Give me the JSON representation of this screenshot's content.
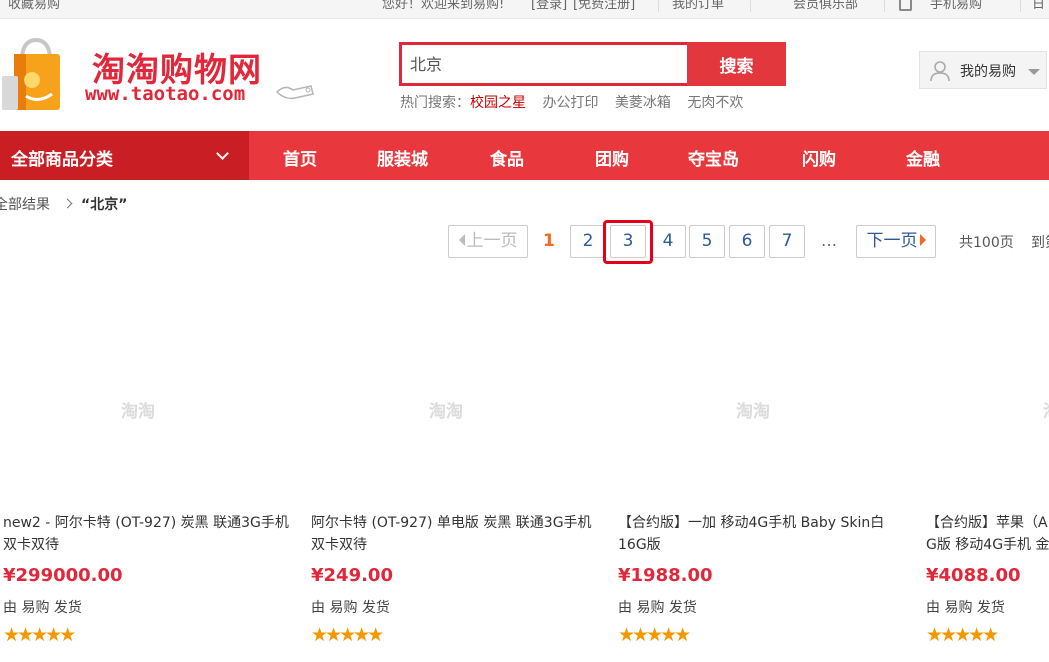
{
  "topbar": {
    "favorite": "收藏易购",
    "welcome": "您好！欢迎来到易购!",
    "login": "[登录]",
    "register": "[免费注册]",
    "my_orders": "我的订单",
    "member_club": "会员俱乐部",
    "mobile": "手机易购",
    "edge": "日"
  },
  "logo": {
    "title": "淘淘购物网",
    "url": "www.taotao.com"
  },
  "search": {
    "value": "北京",
    "button": "搜索",
    "hot_label": "热门搜索：",
    "hot_terms": [
      "校园之星",
      "办公打印",
      "美菱冰箱",
      "无肉不欢"
    ]
  },
  "mybuy": {
    "label": "我的易购"
  },
  "nav": {
    "all_categories": "全部商品分类",
    "items": [
      "首页",
      "服装城",
      "食品",
      "团购",
      "夺宝岛",
      "闪购",
      "金融"
    ]
  },
  "breadcrumb": {
    "root": "全部结果",
    "keyword": "“北京”"
  },
  "pager": {
    "prev": "上一页",
    "current": "1",
    "pages": [
      "2",
      "3",
      "4",
      "5",
      "6",
      "7"
    ],
    "ellipsis": "…",
    "next": "下一页",
    "total": "共100页",
    "goto": "到第"
  },
  "products": [
    {
      "watermark": "淘淘",
      "title": "new2 - 阿尔卡特 (OT-927) 炭黑 联通3G手机 双卡双待",
      "price": "¥299000.00",
      "shipping": "由 易购 发货",
      "rating_stars": 5
    },
    {
      "watermark": "淘淘",
      "title": "阿尔卡特 (OT-927) 单电版 炭黑 联通3G手机 双卡双待",
      "price": "¥249.00",
      "shipping": "由 易购 发货",
      "rating_stars": 5
    },
    {
      "watermark": "淘淘",
      "title": "【合约版】一加 移动4G手机 Baby Skin白 16G版",
      "price": "¥1988.00",
      "shipping": "由 易购 发货",
      "rating_stars": 5
    },
    {
      "watermark": "淘",
      "title": "【合约版】苹果（A G版 移动4G手机 金",
      "price": "¥4088.00",
      "shipping": "由 易购 发货",
      "rating_stars": 5
    }
  ],
  "colors": {
    "brand_red": "#e3273a",
    "nav_red": "#e8383d",
    "nav_dark_red": "#c91f24",
    "pager_current": "#f26a22",
    "pager_link": "#2c5a98",
    "star": "#f39800"
  }
}
